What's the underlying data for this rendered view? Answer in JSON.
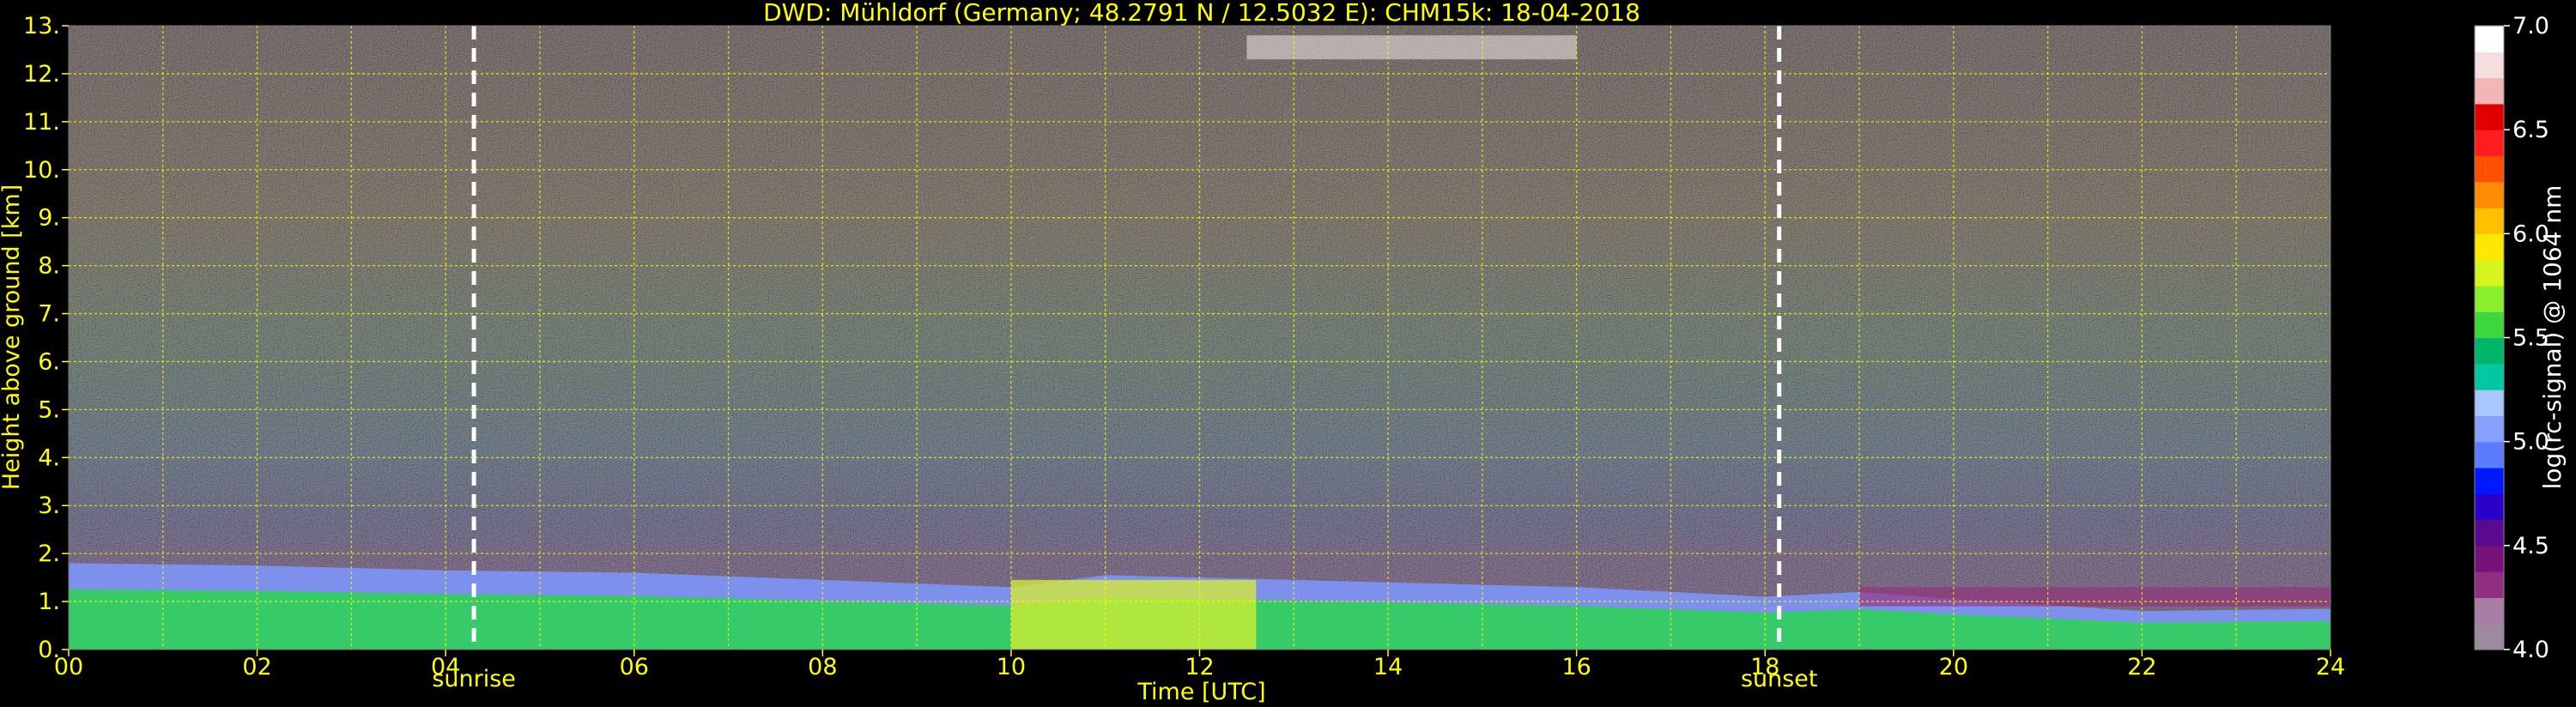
{
  "chart_data": {
    "type": "heatmap",
    "title": "DWD: Mühldorf (Germany; 48.2791 N / 12.5032 E):    CHM15k: 18-04-2018",
    "xlabel": "Time [UTC]",
    "ylabel": "Height above ground [km]",
    "xlim": [
      0,
      24
    ],
    "ylim": [
      0,
      13
    ],
    "x_ticks": [
      "00",
      "02",
      "04",
      "06",
      "08",
      "10",
      "12",
      "14",
      "16",
      "18",
      "20",
      "22",
      "24"
    ],
    "y_ticks": [
      "0.",
      "1.",
      "2.",
      "3.",
      "4.",
      "5.",
      "6.",
      "7.",
      "8.",
      "9.",
      "10.",
      "11.",
      "12.",
      "13."
    ],
    "grid": true,
    "markers": [
      {
        "label": "sunrise",
        "x": 4.3
      },
      {
        "label": "sunset",
        "x": 18.15
      }
    ],
    "boundary_layer_top_km": [
      {
        "x": 0,
        "y": 1.8
      },
      {
        "x": 2,
        "y": 1.75
      },
      {
        "x": 4,
        "y": 1.65
      },
      {
        "x": 6,
        "y": 1.6
      },
      {
        "x": 8,
        "y": 1.45
      },
      {
        "x": 10,
        "y": 1.3
      },
      {
        "x": 11,
        "y": 1.55
      },
      {
        "x": 12,
        "y": 1.5
      },
      {
        "x": 14,
        "y": 1.4
      },
      {
        "x": 16,
        "y": 1.3
      },
      {
        "x": 18,
        "y": 1.1
      },
      {
        "x": 19,
        "y": 1.2
      },
      {
        "x": 20,
        "y": 1.05
      },
      {
        "x": 22,
        "y": 0.8
      },
      {
        "x": 24,
        "y": 0.85
      }
    ],
    "colorbar": {
      "label": "log(rc-signal) @ 1064 nm",
      "range": [
        4.0,
        7.0
      ],
      "ticks": [
        "4.0",
        "4.5",
        "5.0",
        "5.5",
        "6.0",
        "6.5",
        "7.0"
      ],
      "colors": [
        "#9e8aa0",
        "#a97ea6",
        "#8e2f7f",
        "#76127a",
        "#5a0a8e",
        "#2a00c8",
        "#0018ff",
        "#5c7cff",
        "#8aa0ff",
        "#a9c6ff",
        "#00c8a0",
        "#00b46a",
        "#3ed83e",
        "#8aef2e",
        "#d6f51e",
        "#ffe800",
        "#ffc000",
        "#ff8c00",
        "#ff5000",
        "#ff1e1e",
        "#e00000",
        "#f2b6b6",
        "#f4dede",
        "#ffffff"
      ]
    }
  }
}
